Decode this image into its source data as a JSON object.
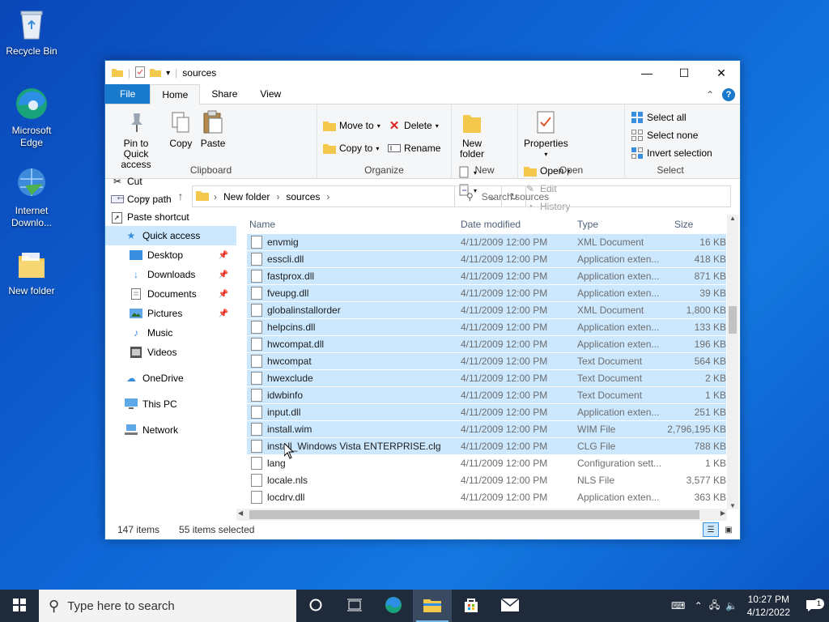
{
  "desktop": {
    "icons": [
      {
        "label": "Recycle Bin"
      },
      {
        "label": "Microsoft Edge"
      },
      {
        "label": "Internet Downlo..."
      },
      {
        "label": "New folder"
      }
    ]
  },
  "window": {
    "title": "sources",
    "ribbon_tabs": [
      "File",
      "Home",
      "Share",
      "View"
    ],
    "clipboard": {
      "pin_label": "Pin to Quick access",
      "copy_label": "Copy",
      "paste_label": "Paste",
      "cut_label": "Cut",
      "copy_path_label": "Copy path",
      "paste_shortcut_label": "Paste shortcut",
      "group_label": "Clipboard"
    },
    "organize": {
      "move_to_label": "Move to",
      "copy_to_label": "Copy to",
      "delete_label": "Delete",
      "rename_label": "Rename",
      "group_label": "Organize"
    },
    "new": {
      "new_folder_label": "New folder",
      "group_label": "New"
    },
    "open": {
      "properties_label": "Properties",
      "open_label": "Open",
      "edit_label": "Edit",
      "history_label": "History",
      "group_label": "Open"
    },
    "select": {
      "select_all_label": "Select all",
      "select_none_label": "Select none",
      "invert_label": "Invert selection",
      "group_label": "Select"
    },
    "address": {
      "crumbs": [
        "New folder",
        "sources"
      ],
      "search_placeholder": "Search sources"
    },
    "nav": {
      "quick_access": "Quick access",
      "items": [
        {
          "label": "Desktop",
          "pinned": true
        },
        {
          "label": "Downloads",
          "pinned": true
        },
        {
          "label": "Documents",
          "pinned": true
        },
        {
          "label": "Pictures",
          "pinned": true
        },
        {
          "label": "Music",
          "pinned": false
        },
        {
          "label": "Videos",
          "pinned": false
        }
      ],
      "onedrive": "OneDrive",
      "this_pc": "This PC",
      "network": "Network"
    },
    "columns": {
      "name": "Name",
      "date": "Date modified",
      "type": "Type",
      "size": "Size"
    },
    "files": [
      {
        "name": "envmig",
        "date": "4/11/2009 12:00 PM",
        "type": "XML Document",
        "size": "16 KB",
        "selected": true
      },
      {
        "name": "esscli.dll",
        "date": "4/11/2009 12:00 PM",
        "type": "Application exten...",
        "size": "418 KB",
        "selected": true
      },
      {
        "name": "fastprox.dll",
        "date": "4/11/2009 12:00 PM",
        "type": "Application exten...",
        "size": "871 KB",
        "selected": true
      },
      {
        "name": "fveupg.dll",
        "date": "4/11/2009 12:00 PM",
        "type": "Application exten...",
        "size": "39 KB",
        "selected": true
      },
      {
        "name": "globalinstallorder",
        "date": "4/11/2009 12:00 PM",
        "type": "XML Document",
        "size": "1,800 KB",
        "selected": true
      },
      {
        "name": "helpcins.dll",
        "date": "4/11/2009 12:00 PM",
        "type": "Application exten...",
        "size": "133 KB",
        "selected": true
      },
      {
        "name": "hwcompat.dll",
        "date": "4/11/2009 12:00 PM",
        "type": "Application exten...",
        "size": "196 KB",
        "selected": true
      },
      {
        "name": "hwcompat",
        "date": "4/11/2009 12:00 PM",
        "type": "Text Document",
        "size": "564 KB",
        "selected": true
      },
      {
        "name": "hwexclude",
        "date": "4/11/2009 12:00 PM",
        "type": "Text Document",
        "size": "2 KB",
        "selected": true
      },
      {
        "name": "idwbinfo",
        "date": "4/11/2009 12:00 PM",
        "type": "Text Document",
        "size": "1 KB",
        "selected": true
      },
      {
        "name": "input.dll",
        "date": "4/11/2009 12:00 PM",
        "type": "Application exten...",
        "size": "251 KB",
        "selected": true
      },
      {
        "name": "install.wim",
        "date": "4/11/2009 12:00 PM",
        "type": "WIM File",
        "size": "2,796,195 KB",
        "selected": true
      },
      {
        "name": "install_Windows Vista ENTERPRISE.clg",
        "date": "4/11/2009 12:00 PM",
        "type": "CLG File",
        "size": "788 KB",
        "selected": true
      },
      {
        "name": "lang",
        "date": "4/11/2009 12:00 PM",
        "type": "Configuration sett...",
        "size": "1 KB",
        "selected": false
      },
      {
        "name": "locale.nls",
        "date": "4/11/2009 12:00 PM",
        "type": "NLS File",
        "size": "3,577 KB",
        "selected": false
      },
      {
        "name": "locdrv.dll",
        "date": "4/11/2009 12:00 PM",
        "type": "Application exten...",
        "size": "363 KB",
        "selected": false
      }
    ],
    "status": {
      "items": "147 items",
      "selected": "55 items selected"
    }
  },
  "taskbar": {
    "search_placeholder": "Type here to search",
    "time": "10:27 PM",
    "date": "4/12/2022",
    "notification_count": "1"
  },
  "colors": {
    "accent": "#1979ca",
    "selection": "#cce8ff",
    "taskbar": "#1f2a3a"
  }
}
